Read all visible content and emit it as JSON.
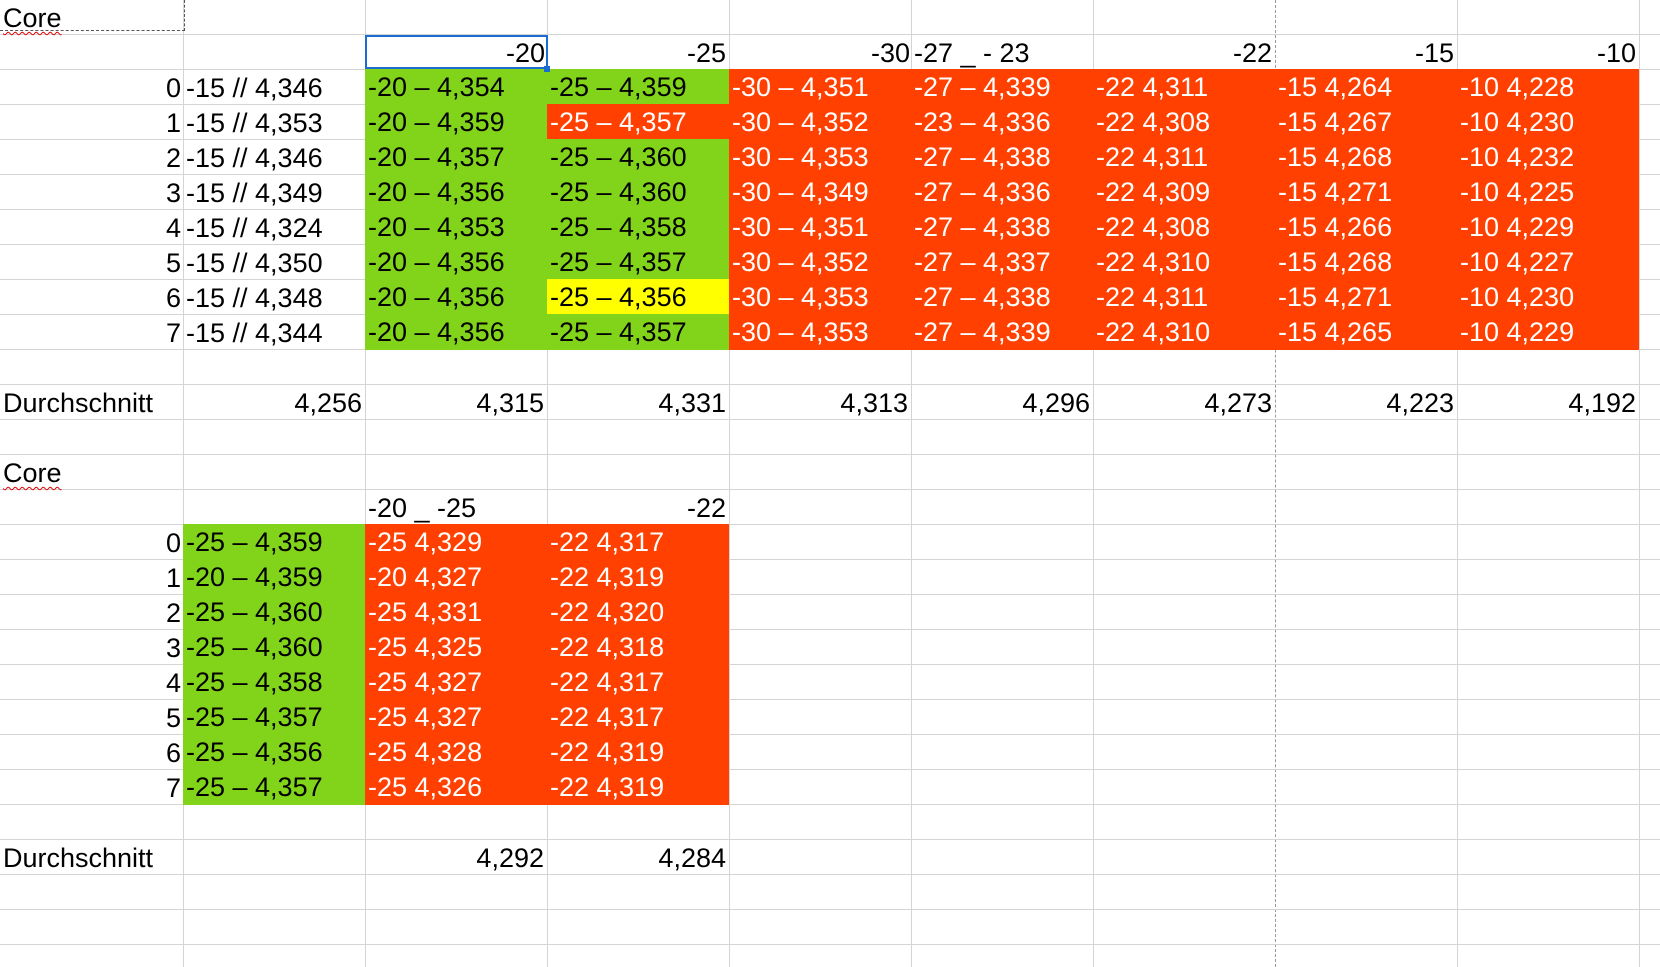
{
  "block1": {
    "title": "Core",
    "headers": [
      "-20",
      "-25",
      "-30",
      "-27 _ - 23",
      "-22",
      "-15",
      "-10"
    ],
    "rows": [
      {
        "idx": "0",
        "cells": [
          "-15 // 4,346",
          "-20 – 4,354",
          "-25 – 4,359",
          "-30 – 4,351",
          "-27 – 4,339",
          "-22 4,311",
          "-15 4,264",
          "-10 4,228"
        ]
      },
      {
        "idx": "1",
        "cells": [
          "-15 // 4,353",
          "-20 – 4,359",
          "-25 – 4,357",
          "-30 – 4,352",
          "-23 – 4,336",
          "-22 4,308",
          "-15 4,267",
          "-10 4,230"
        ]
      },
      {
        "idx": "2",
        "cells": [
          "-15 // 4,346",
          "-20 – 4,357",
          "-25 – 4,360",
          "-30 – 4,353",
          "-27 – 4,338",
          "-22 4,311",
          "-15 4,268",
          "-10 4,232"
        ]
      },
      {
        "idx": "3",
        "cells": [
          "-15 // 4,349",
          "-20 – 4,356",
          "-25 – 4,360",
          "-30 – 4,349",
          "-27 – 4,336",
          "-22 4,309",
          "-15 4,271",
          "-10 4,225"
        ]
      },
      {
        "idx": "4",
        "cells": [
          "-15 // 4,324",
          "-20 – 4,353",
          "-25 – 4,358",
          "-30 – 4,351",
          "-27 – 4,338",
          "-22 4,308",
          "-15 4,266",
          "-10 4,229"
        ]
      },
      {
        "idx": "5",
        "cells": [
          "-15 // 4,350",
          "-20 – 4,356",
          "-25 – 4,357",
          "-30 – 4,352",
          "-27 – 4,337",
          "-22 4,310",
          "-15 4,268",
          "-10 4,227"
        ]
      },
      {
        "idx": "6",
        "cells": [
          "-15 // 4,348",
          "-20 – 4,356",
          "-25 – 4,356",
          "-30 – 4,353",
          "-27 – 4,338",
          "-22 4,311",
          "-15 4,271",
          "-10 4,230"
        ]
      },
      {
        "idx": "7",
        "cells": [
          "-15 // 4,344",
          "-20 – 4,356",
          "-25 – 4,357",
          "-30 – 4,353",
          "-27 – 4,339",
          "-22 4,310",
          "-15 4,265",
          "-10 4,229"
        ]
      }
    ],
    "average_label": "Durchschnitt",
    "averages": [
      "4,256",
      "4,315",
      "4,331",
      "4,313",
      "4,296",
      "4,273",
      "4,223",
      "4,192"
    ]
  },
  "block2": {
    "title": "Core",
    "headers": [
      "-20 _ -25",
      "-22"
    ],
    "rows": [
      {
        "idx": "0",
        "cells": [
          "-25 – 4,359",
          "-25 4,329",
          "-22 4,317"
        ]
      },
      {
        "idx": "1",
        "cells": [
          "-20 – 4,359",
          "-20 4,327",
          "-22 4,319"
        ]
      },
      {
        "idx": "2",
        "cells": [
          "-25 – 4,360",
          "-25 4,331",
          "-22 4,320"
        ]
      },
      {
        "idx": "3",
        "cells": [
          "-25 – 4,360",
          "-25 4,325",
          "-22 4,318"
        ]
      },
      {
        "idx": "4",
        "cells": [
          "-25 – 4,358",
          "-25 4,327",
          "-22 4,317"
        ]
      },
      {
        "idx": "5",
        "cells": [
          "-25 – 4,357",
          "-25 4,327",
          "-22 4,317"
        ]
      },
      {
        "idx": "6",
        "cells": [
          "-25 – 4,356",
          "-25 4,328",
          "-22 4,319"
        ]
      },
      {
        "idx": "7",
        "cells": [
          "-25 – 4,357",
          "-25 4,326",
          "-22 4,319"
        ]
      }
    ],
    "average_label": "Durchschnitt",
    "averages": [
      "",
      "4,292",
      "4,284"
    ]
  },
  "colors": {
    "green": "#81d41a",
    "red": "#ff4000",
    "yellow": "#ffff00",
    "selection": "#1c6cd2",
    "gridline": "#d4d4d4"
  }
}
